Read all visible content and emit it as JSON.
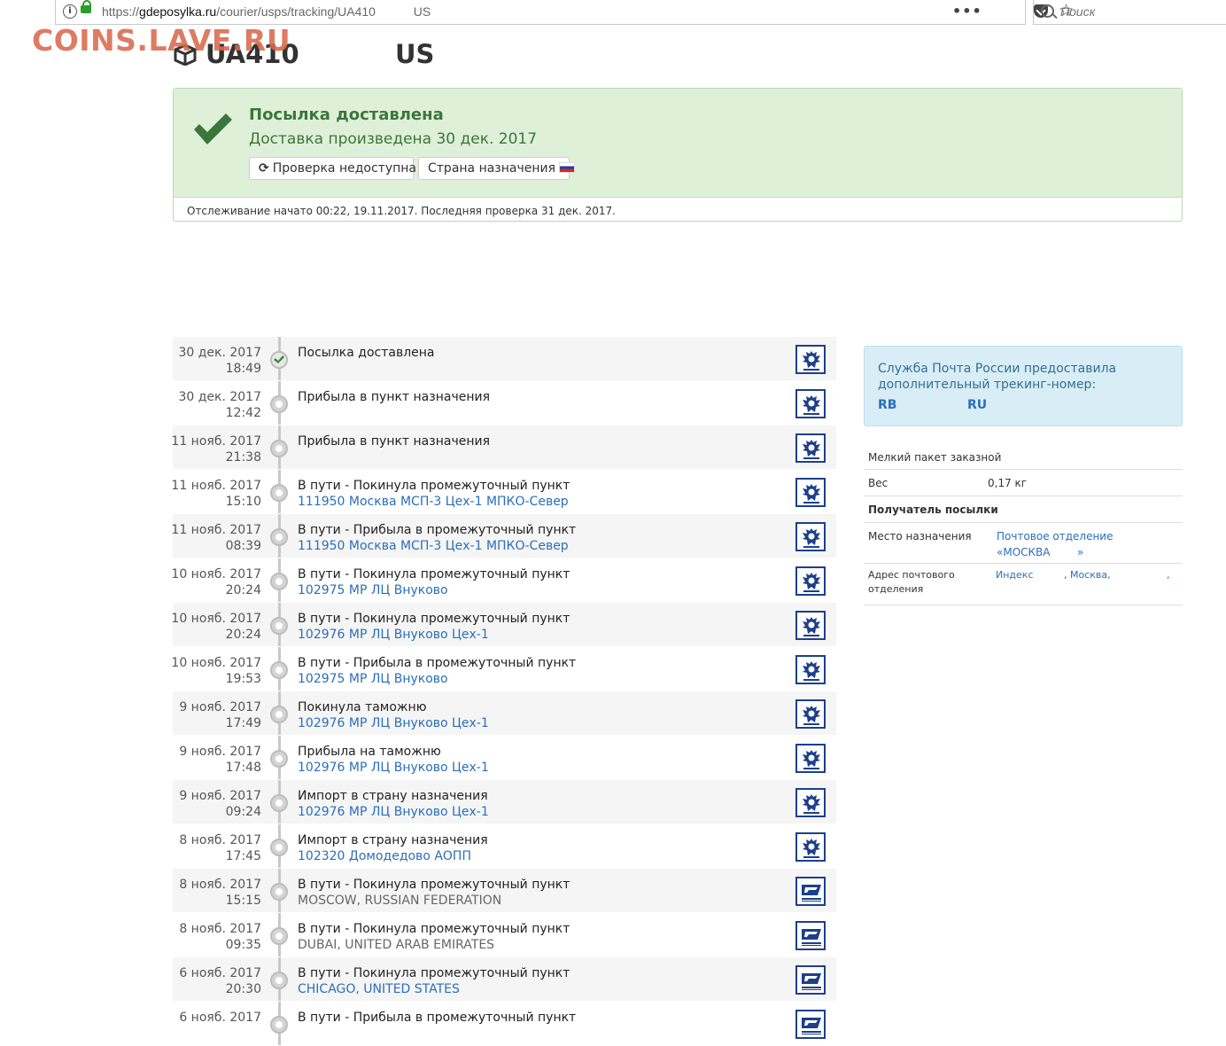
{
  "browser": {
    "url_prefix": "https://",
    "url_domain": "gdeposylka.ru",
    "url_path": "/courier/usps/tracking/UA410",
    "url_suffix": "US",
    "search_placeholder": "Поиск"
  },
  "watermark": "COINS.LAVE.RU",
  "header": {
    "tracking_number": "UA410",
    "country_suffix": "US"
  },
  "status": {
    "title": "Посылка доставлена",
    "subtitle": "Доставка произведена 30 дек. 2017",
    "refresh_button": "Проверка недоступна",
    "country_button": "Страна назначения",
    "footer": "Отслеживание начато 00:22, 19.11.2017. Последняя проверка 31 дек. 2017."
  },
  "timeline": [
    {
      "date": "30 дек. 2017",
      "time": "18:49",
      "event": "Посылка доставлена",
      "location": "",
      "loc_style": "link",
      "carrier": "russian-post",
      "done": true
    },
    {
      "date": "30 дек. 2017",
      "time": "12:42",
      "event": "Прибыла в пункт назначения",
      "location": "",
      "loc_style": "link",
      "carrier": "russian-post",
      "done": false
    },
    {
      "date": "11 нояб. 2017",
      "time": "21:38",
      "event": "Прибыла в пункт назначения",
      "location": "",
      "loc_style": "link",
      "carrier": "russian-post",
      "done": false
    },
    {
      "date": "11 нояб. 2017",
      "time": "15:10",
      "event": "В пути - Покинула промежуточный пункт",
      "location": "111950 Москва МСП-3 Цех-1 МПКО-Север",
      "loc_style": "link",
      "carrier": "russian-post",
      "done": false
    },
    {
      "date": "11 нояб. 2017",
      "time": "08:39",
      "event": "В пути - Прибыла в промежуточный пункт",
      "location": "111950 Москва МСП-3 Цех-1 МПКО-Север",
      "loc_style": "link",
      "carrier": "russian-post",
      "done": false
    },
    {
      "date": "10 нояб. 2017",
      "time": "20:24",
      "event": "В пути - Покинула промежуточный пункт",
      "location": "102975 МР ЛЦ Внуково",
      "loc_style": "link",
      "carrier": "russian-post",
      "done": false
    },
    {
      "date": "10 нояб. 2017",
      "time": "20:24",
      "event": "В пути - Покинула промежуточный пункт",
      "location": "102976 МР ЛЦ Внуково Цех-1",
      "loc_style": "link",
      "carrier": "russian-post",
      "done": false
    },
    {
      "date": "10 нояб. 2017",
      "time": "19:53",
      "event": "В пути - Прибыла в промежуточный пункт",
      "location": "102975 МР ЛЦ Внуково",
      "loc_style": "link",
      "carrier": "russian-post",
      "done": false
    },
    {
      "date": "9 нояб. 2017",
      "time": "17:49",
      "event": "Покинула таможню",
      "location": "102976 МР ЛЦ Внуково Цех-1",
      "loc_style": "link",
      "carrier": "russian-post",
      "done": false
    },
    {
      "date": "9 нояб. 2017",
      "time": "17:48",
      "event": "Прибыла на таможню",
      "location": "102976 МР ЛЦ Внуково Цех-1",
      "loc_style": "link",
      "carrier": "russian-post",
      "done": false
    },
    {
      "date": "9 нояб. 2017",
      "time": "09:24",
      "event": "Импорт в страну назначения",
      "location": "102976 МР ЛЦ Внуково Цех-1",
      "loc_style": "link",
      "carrier": "russian-post",
      "done": false
    },
    {
      "date": "8 нояб. 2017",
      "time": "17:45",
      "event": "Импорт в страну назначения",
      "location": "102320 Домодедово АОПП",
      "loc_style": "link",
      "carrier": "russian-post",
      "done": false
    },
    {
      "date": "8 нояб. 2017",
      "time": "15:15",
      "event": "В пути - Покинула промежуточный пункт",
      "location": "MOSCOW, RUSSIAN FEDERATION",
      "loc_style": "gray",
      "carrier": "usps",
      "done": false
    },
    {
      "date": "8 нояб. 2017",
      "time": "09:35",
      "event": "В пути - Покинула промежуточный пункт",
      "location": "DUBAI, UNITED ARAB EMIRATES",
      "loc_style": "gray",
      "carrier": "usps",
      "done": false
    },
    {
      "date": "6 нояб. 2017",
      "time": "20:30",
      "event": "В пути - Покинула промежуточный пункт",
      "location": "CHICAGO, UNITED STATES",
      "loc_style": "link",
      "carrier": "usps",
      "done": false
    },
    {
      "date": "6 нояб. 2017",
      "time": "",
      "event": "В пути - Прибыла в промежуточный пункт",
      "location": "",
      "loc_style": "link",
      "carrier": "usps",
      "done": false
    }
  ],
  "sidebar": {
    "alt_tracking_text": "Служба Почта России предоставила дополнительный трекинг-номер:",
    "alt_code_1": "RB",
    "alt_code_2": "RU",
    "package_type": "Мелкий пакет заказной",
    "weight_label": "Вес",
    "weight_value": "0,17 кг",
    "recipient_heading": "Получатель посылки",
    "destination_label": "Место назначения",
    "destination_value_1": "Почтовое отделение",
    "destination_value_2": "«МОСКВА        »",
    "address_label_1": "Адрес почтового",
    "address_label_2": "отделения",
    "address_index": "Индекс",
    "address_city": ", Москва,",
    "address_tail": ","
  },
  "colors": {
    "success_bg": "#dff0d8",
    "success_text": "#3b763d",
    "link": "#2a6ebb",
    "info_bg": "#d9edf7"
  }
}
